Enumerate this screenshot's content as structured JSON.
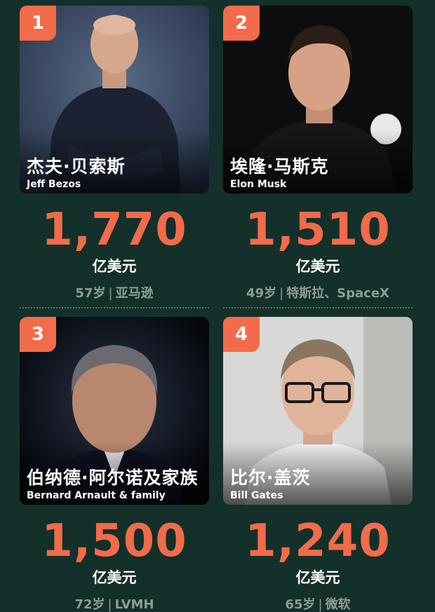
{
  "entries": [
    {
      "rank": "1",
      "name_cn": "杰夫·贝索斯",
      "name_en": "Jeff Bezos",
      "amount": "1,770",
      "unit": "亿美元",
      "age": "57岁",
      "company": "亚马逊"
    },
    {
      "rank": "2",
      "name_cn": "埃隆·马斯克",
      "name_en": "Elon Musk",
      "amount": "1,510",
      "unit": "亿美元",
      "age": "49岁",
      "company": "特斯拉、SpaceX"
    },
    {
      "rank": "3",
      "name_cn": "伯纳德·阿尔诺及家族",
      "name_en": "Bernard Arnault & family",
      "amount": "1,500",
      "unit": "亿美元",
      "age": "72岁",
      "company": "LVMH"
    },
    {
      "rank": "4",
      "name_cn": "比尔·盖茨",
      "name_en": "Bill Gates",
      "amount": "1,240",
      "unit": "亿美元",
      "age": "65岁",
      "company": "微软"
    }
  ],
  "separator": "|",
  "colors": {
    "background": "#14302a",
    "accent": "#f26b4a",
    "muted_text": "#8e9c97"
  }
}
